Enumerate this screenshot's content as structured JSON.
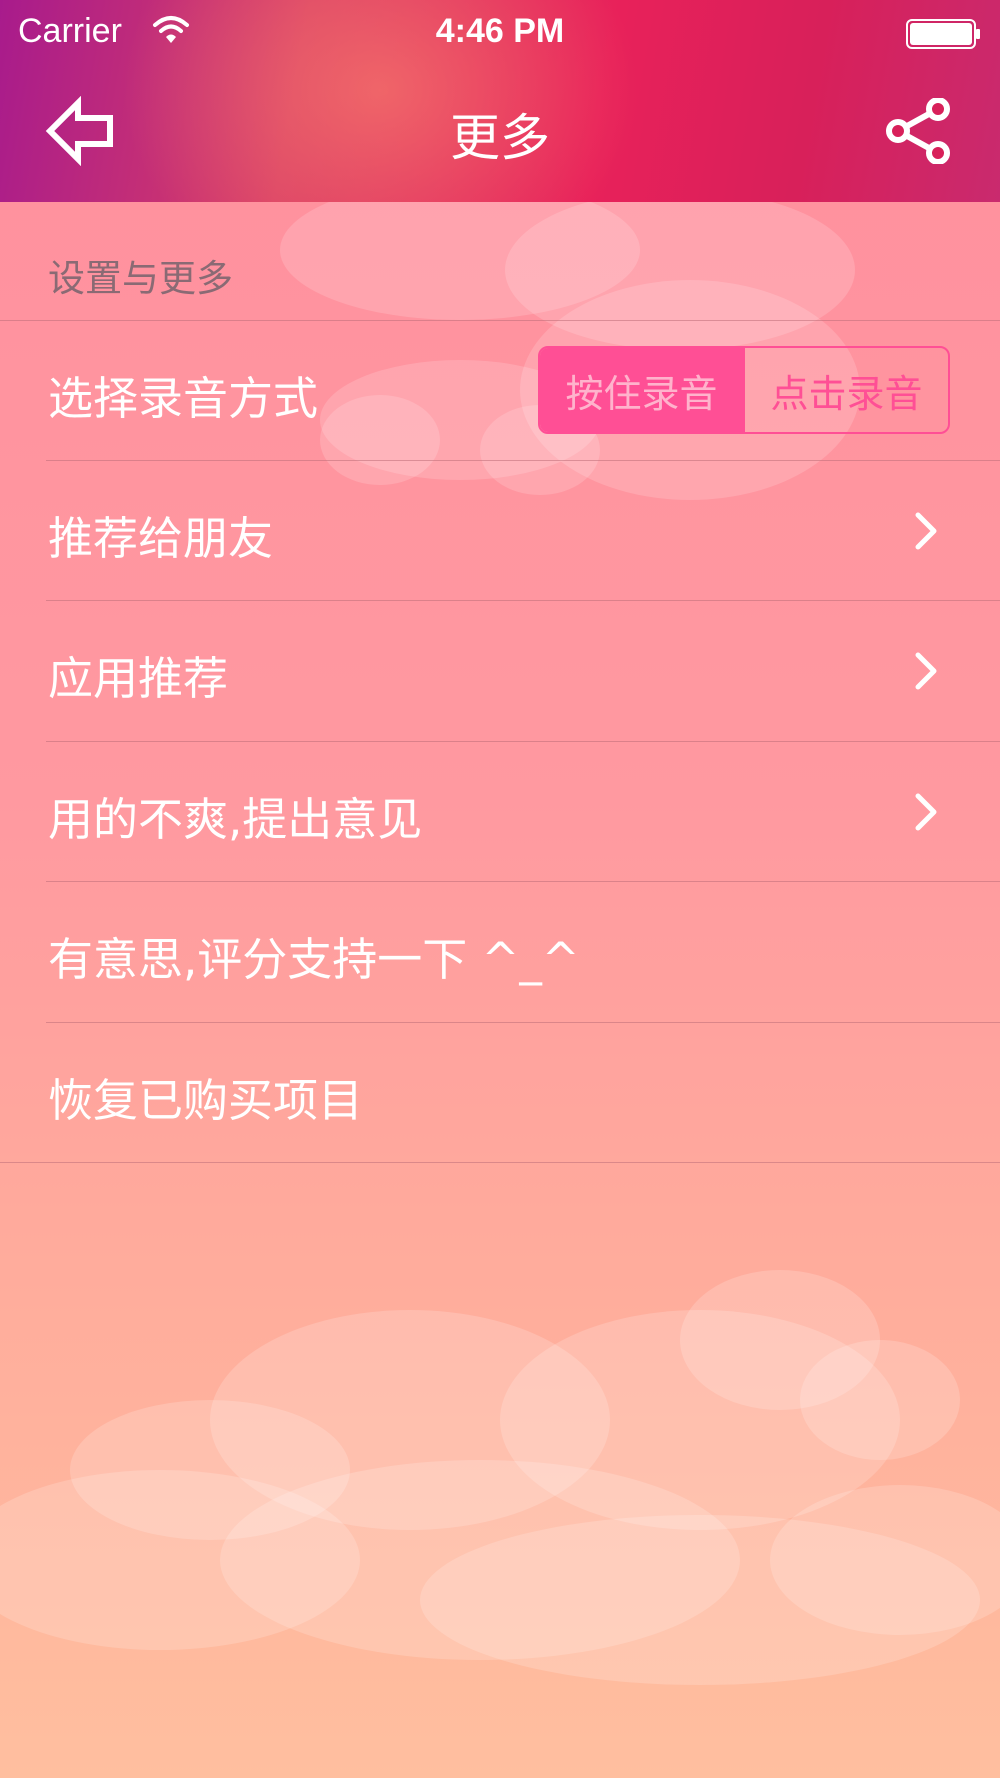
{
  "status_bar": {
    "carrier": "Carrier",
    "time": "4:46 PM"
  },
  "header": {
    "title": "更多"
  },
  "section": {
    "title": "设置与更多"
  },
  "recording_mode": {
    "label": "选择录音方式",
    "options": [
      "按住录音",
      "点击录音"
    ],
    "selected_index": 0
  },
  "menu": {
    "recommend_friends": "推荐给朋友",
    "app_recommend": "应用推荐",
    "feedback": "用的不爽,提出意见",
    "rate": "有意思,评分支持一下 ^_^",
    "restore": "恢复已购买项目"
  },
  "colors": {
    "accent": "#ff4f95",
    "header_start": "#a81b8c",
    "header_end": "#e8215a"
  },
  "icons": {
    "back": "back-arrow-icon",
    "share": "share-icon",
    "chevron": "chevron-right-icon"
  }
}
